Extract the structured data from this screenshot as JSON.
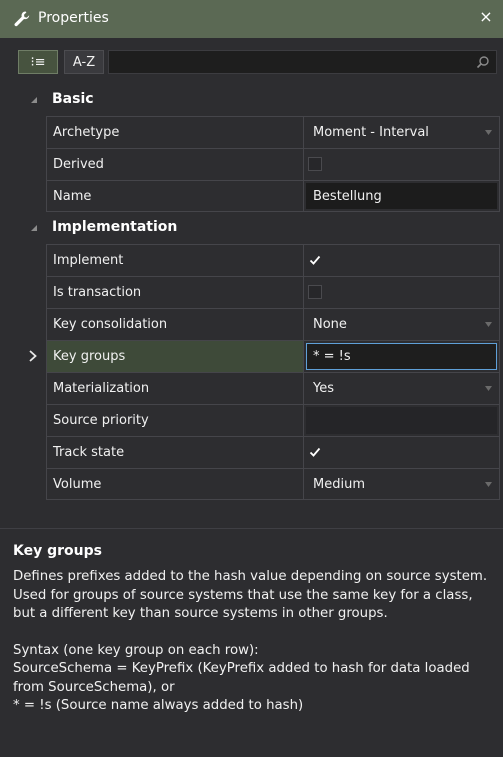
{
  "window": {
    "title": "Properties",
    "close_glyph": "×"
  },
  "toolbar": {
    "categorized_label": "⁝≡",
    "alphabetical_label": "A-Z",
    "search_value": ""
  },
  "categories": [
    {
      "label": "Basic",
      "rows": [
        {
          "name": "Archetype",
          "value": "Moment - Interval",
          "editor": "dropdown"
        },
        {
          "name": "Derived",
          "value": "",
          "editor": "checkbox",
          "checked": false
        },
        {
          "name": "Name",
          "value": "Bestellung",
          "editor": "text"
        }
      ]
    },
    {
      "label": "Implementation",
      "rows": [
        {
          "name": "Implement",
          "value": "",
          "editor": "checkbox",
          "checked": true
        },
        {
          "name": "Is transaction",
          "value": "",
          "editor": "checkbox",
          "checked": false
        },
        {
          "name": "Key consolidation",
          "value": "None",
          "editor": "dropdown"
        },
        {
          "name": "Key groups",
          "value": "* = !s",
          "editor": "text-active",
          "selected": true
        },
        {
          "name": "Materialization",
          "value": "Yes",
          "editor": "dropdown"
        },
        {
          "name": "Source priority",
          "value": "",
          "editor": "text-empty"
        },
        {
          "name": "Track state",
          "value": "",
          "editor": "checkbox",
          "checked": true
        },
        {
          "name": "Volume",
          "value": "Medium",
          "editor": "dropdown"
        }
      ]
    }
  ],
  "description": {
    "title": "Key groups",
    "para1": "Defines prefixes added to the hash value depending on source system. Used for groups of source systems that use the same key for a class, but a different key than source systems in other groups.",
    "line1": "Syntax (one key group on each row):",
    "line2": "SourceSchema = KeyPrefix (KeyPrefix added to hash for data loaded from SourceSchema), or",
    "line3": "* = !s (Source name always added to hash)"
  },
  "colors": {
    "titlebar": "#5b6954",
    "selected_row": "#3e4a39",
    "active_border": "#5fa0d8",
    "background": "#2d2d30"
  },
  "icons": {
    "title": "wrench-icon",
    "close": "close-icon",
    "search": "search-icon",
    "category_toggle": "collapse-triangle-icon",
    "row_marker": "chevron-right-icon",
    "dropdown": "dropdown-arrow-icon",
    "check": "checkmark-icon"
  }
}
